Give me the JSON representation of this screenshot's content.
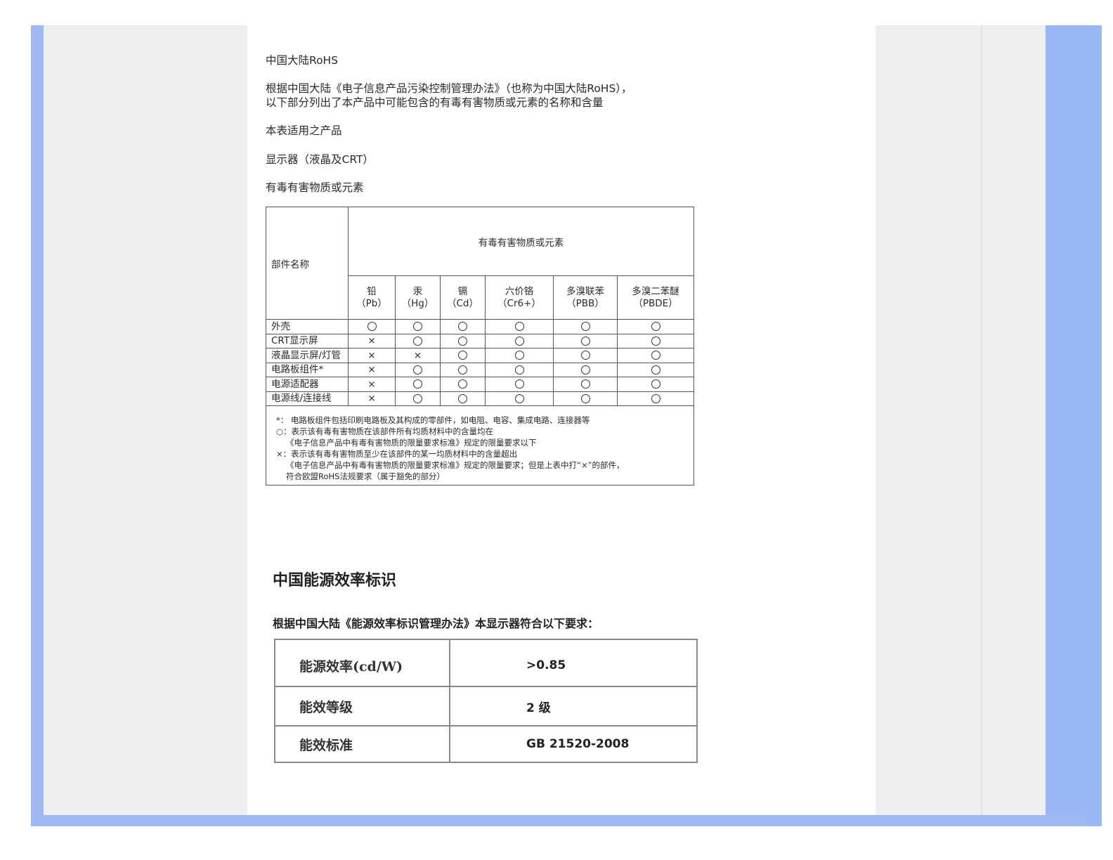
{
  "section1": {
    "title": "中国大陆RoHS",
    "intro_line1": "根据中国大陆《电子信息产品污染控制管理办法》（也称为中国大陆RoHS），",
    "intro_line2": "以下部分列出了本产品中可能包含的有毒有害物质或元素的名称和含量",
    "applies": "本表适用之产品",
    "product": "显示器（液晶及CRT）",
    "substances_label": "有毒有害物质或元素"
  },
  "rohs_table": {
    "part_header": "部件名称",
    "group_header": "有毒有害物质或元素",
    "columns": [
      {
        "name": "铅",
        "symbol": "（Pb）"
      },
      {
        "name": "汞",
        "symbol": "（Hg）"
      },
      {
        "name": "镉",
        "symbol": "（Cd）"
      },
      {
        "name": "六价铬",
        "symbol": "（Cr6+）"
      },
      {
        "name": "多溴联苯",
        "symbol": "（PBB）"
      },
      {
        "name": "多溴二苯醚",
        "symbol": "（PBDE）"
      }
    ],
    "rows": [
      {
        "part": "外壳",
        "marks": [
          "○",
          "○",
          "○",
          "○",
          "○",
          "○"
        ]
      },
      {
        "part": "CRT显示屏",
        "marks": [
          "×",
          "○",
          "○",
          "○",
          "○",
          "○"
        ]
      },
      {
        "part": "液晶显示屏/灯管",
        "marks": [
          "×",
          "×",
          "○",
          "○",
          "○",
          "○"
        ]
      },
      {
        "part": "电路板组件*",
        "marks": [
          "×",
          "○",
          "○",
          "○",
          "○",
          "○"
        ]
      },
      {
        "part": "电源适配器",
        "marks": [
          "×",
          "○",
          "○",
          "○",
          "○",
          "○"
        ]
      },
      {
        "part": "电源线/连接线",
        "marks": [
          "×",
          "○",
          "○",
          "○",
          "○",
          "○"
        ]
      }
    ],
    "notes": [
      "*：  电路板组件包括印刷电路板及其构成的零部件，如电阻、电容、集成电路、连接器等",
      "○：表示该有毒有害物质在该部件所有均质材料中的含量均在",
      "《电子信息产品中有毒有害物质的限量要求标准》规定的限量要求以下",
      "×：表示该有毒有害物质至少在该部件的某一均质材料中的含量超出",
      "《电子信息产品中有毒有害物质的限量要求标准》规定的限量要求；但是上表中打“×”的部件，",
      "符合欧盟RoHS法规要求（属于豁免的部分）"
    ]
  },
  "section2": {
    "title": "中国能源效率标识",
    "intro": "根据中国大陆《能源效率标识管理办法》本显示器符合以下要求：",
    "rows": [
      {
        "label": "能源效率(cd/W)",
        "value": ">0.85"
      },
      {
        "label": "能效等级",
        "value": "2 级"
      },
      {
        "label": "能效标准",
        "value": "GB 21520-2008"
      }
    ]
  }
}
